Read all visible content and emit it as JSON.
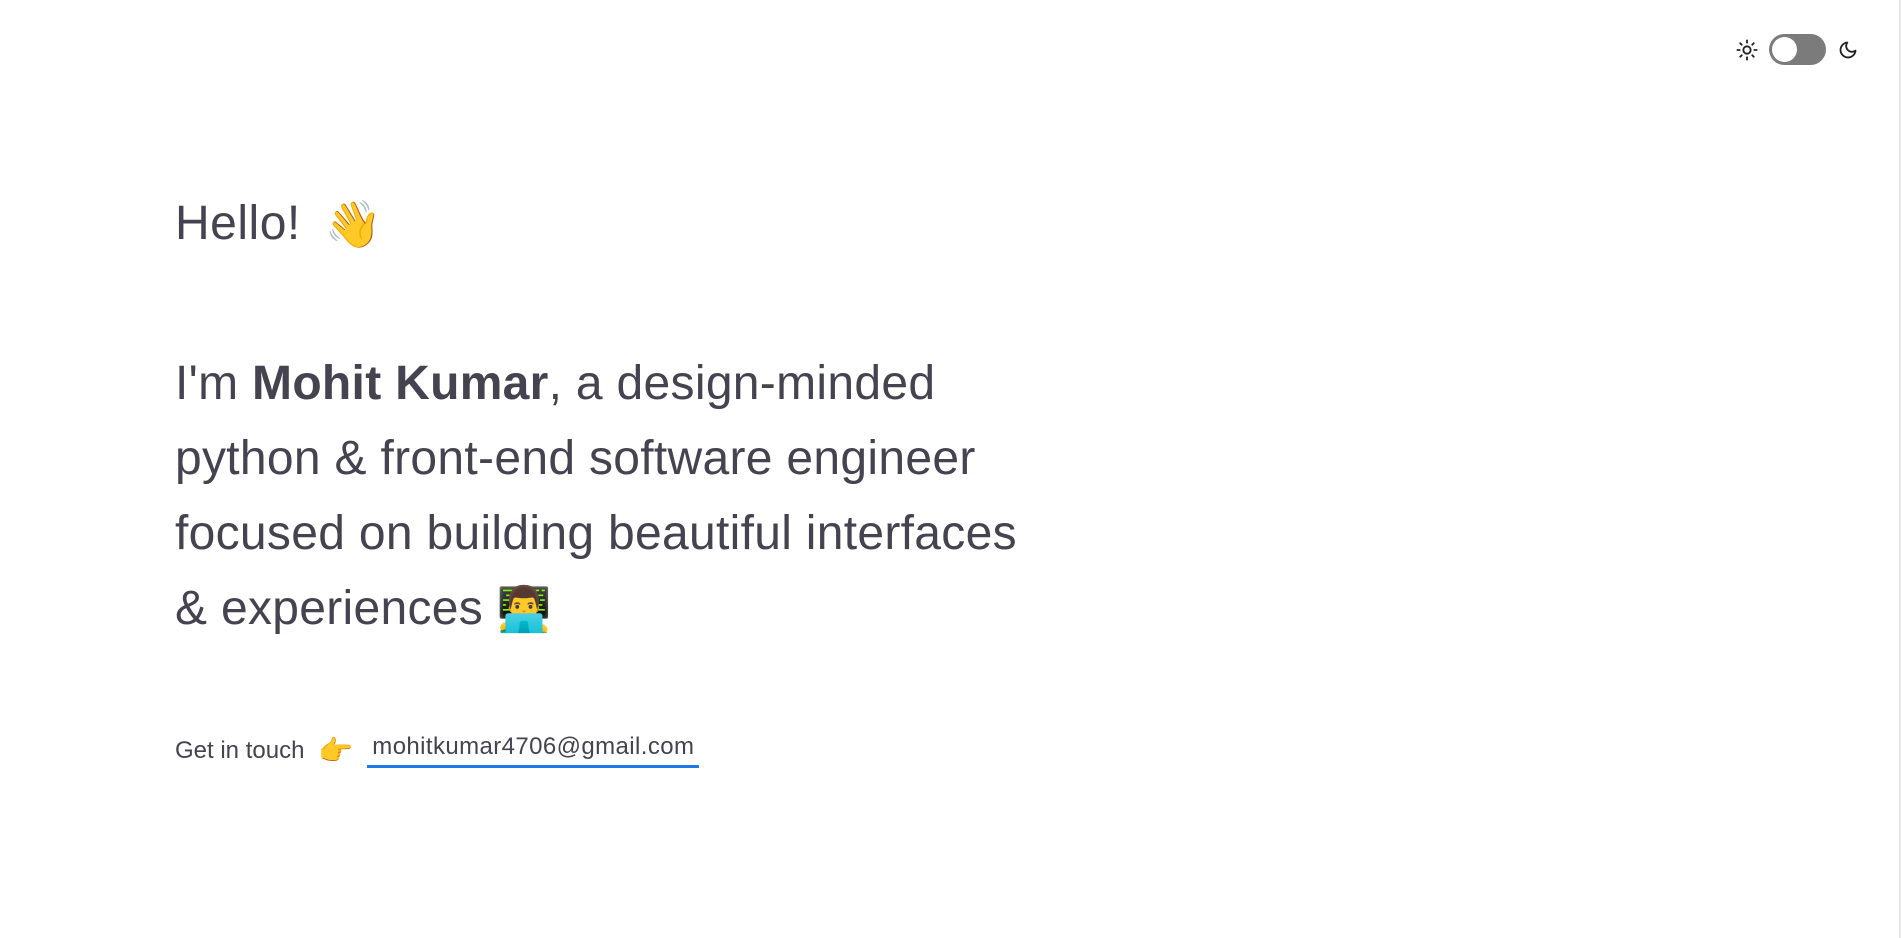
{
  "theme_toggle": {
    "light_icon": "sun-icon",
    "dark_icon": "moon-icon",
    "state": "light"
  },
  "hero": {
    "greeting": "Hello!",
    "greeting_emoji": "👋",
    "intro_prefix": "I'm ",
    "name": "Mohit Kumar",
    "intro_rest": ", a design-minded python & front-end software engineer focused on building beautiful interfaces & experiences ",
    "intro_emoji": "👨‍💻"
  },
  "contact": {
    "label": "Get in touch",
    "pointer_emoji": "👉",
    "email": "mohitkumar4706@gmail.com"
  },
  "colors": {
    "text": "#44434f",
    "link_underline": "#1e7be6",
    "toggle_track": "#7b7b7b",
    "background": "#ffffff"
  }
}
